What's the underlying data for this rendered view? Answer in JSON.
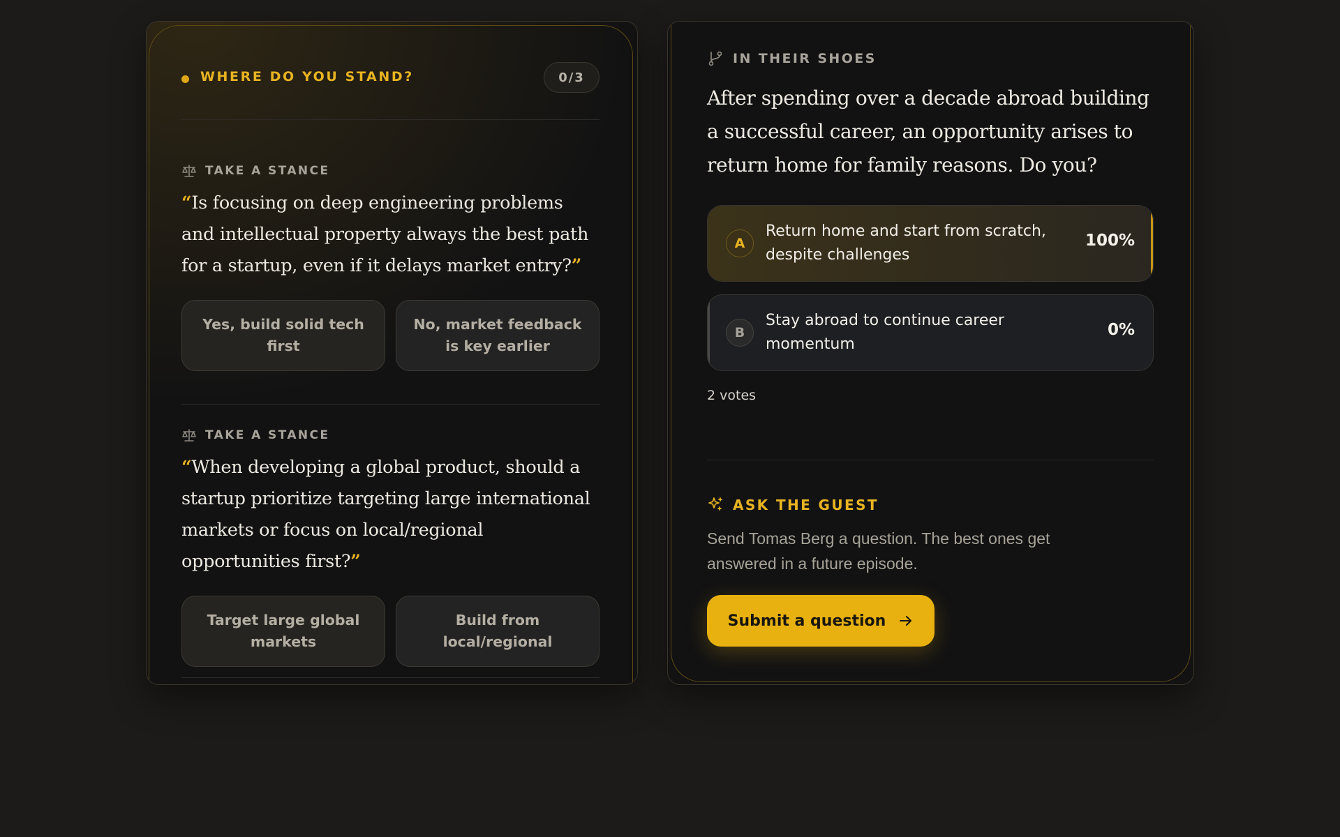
{
  "stances_panel": {
    "title": "WHERE DO YOU STAND?",
    "progress": "0/3",
    "stances": [
      {
        "label": "TAKE A STANCE",
        "question": "Is focusing on deep engineering problems and intellectual property always the best path for a startup, even if it delays market entry?",
        "options": [
          "Yes, build solid tech first",
          "No, market feedback is key earlier"
        ]
      },
      {
        "label": "TAKE A STANCE",
        "question": "When developing a global product, should a startup prioritize targeting large international markets or focus on local/regional opportunities first?",
        "options": [
          "Target large global markets",
          "Build from local/regional"
        ]
      }
    ]
  },
  "shoes_panel": {
    "label": "IN THEIR SHOES",
    "scenario": "After spending over a decade abroad building a successful career, an opportunity arises to return home for family reasons. Do you?",
    "options": [
      {
        "letter": "A",
        "text": "Return home and start from scratch, despite challenges",
        "percent_label": "100%",
        "fraction": 1.0
      },
      {
        "letter": "B",
        "text": "Stay abroad to continue career momentum",
        "percent_label": "0%",
        "fraction": 0.0
      }
    ],
    "votes": "2 votes"
  },
  "ask_guest": {
    "label": "ASK THE GUEST",
    "description": "Send Tomas Berg a question. The best ones get answered in a future episode.",
    "button_label": "Submit a question"
  },
  "colors": {
    "accent": "#e8b10f",
    "background": "#1c1b19",
    "card": "#121213"
  },
  "icons": [
    "scale-icon",
    "signpost-icon",
    "sparkle-icon",
    "arrow-right-icon"
  ]
}
